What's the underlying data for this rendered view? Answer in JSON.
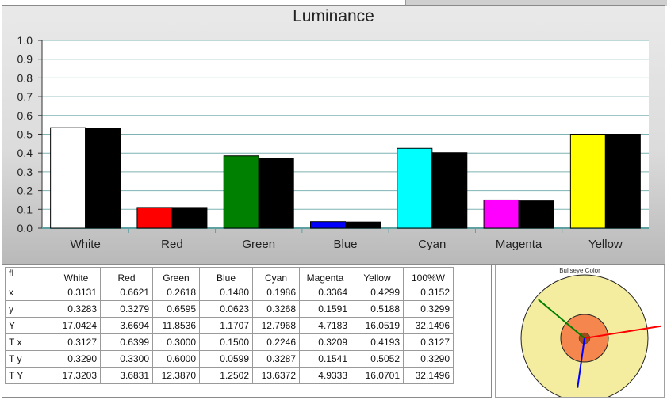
{
  "chart_data": {
    "type": "bar",
    "title": "Luminance",
    "categories": [
      "White",
      "Red",
      "Green",
      "Blue",
      "Cyan",
      "Magenta",
      "Yellow"
    ],
    "series": [
      {
        "values": [
          0.535,
          0.11,
          0.385,
          0.035,
          0.425,
          0.15,
          0.5
        ],
        "colors": [
          "#ffffff",
          "#ff0000",
          "#008000",
          "#0000ff",
          "#00ffff",
          "#ff00ff",
          "#ffff00"
        ]
      },
      {
        "values": [
          0.532,
          0.11,
          0.372,
          0.033,
          0.402,
          0.145,
          0.5
        ],
        "colors": [
          "#000000",
          "#000000",
          "#000000",
          "#000000",
          "#000000",
          "#000000",
          "#000000"
        ]
      }
    ],
    "ylim": [
      0,
      1.0
    ],
    "yticks": [
      "0.0",
      "0.1",
      "0.2",
      "0.3",
      "0.4",
      "0.5",
      "0.6",
      "0.7",
      "0.8",
      "0.9",
      "1.0"
    ],
    "grid": true
  },
  "table": {
    "corner": "fL",
    "columns": [
      "White",
      "Red",
      "Green",
      "Blue",
      "Cyan",
      "Magenta",
      "Yellow",
      "100%W"
    ],
    "rows": [
      {
        "label": "x",
        "values": [
          "0.3131",
          "0.6621",
          "0.2618",
          "0.1480",
          "0.1986",
          "0.3364",
          "0.4299",
          "0.3152"
        ]
      },
      {
        "label": "y",
        "values": [
          "0.3283",
          "0.3279",
          "0.6595",
          "0.0623",
          "0.3268",
          "0.1591",
          "0.5188",
          "0.3299"
        ]
      },
      {
        "label": "Y",
        "values": [
          "17.0424",
          "3.6694",
          "11.8536",
          "1.1707",
          "12.7968",
          "4.7183",
          "16.0519",
          "32.1496"
        ]
      },
      {
        "label": "T x",
        "values": [
          "0.3127",
          "0.6399",
          "0.3000",
          "0.1500",
          "0.2246",
          "0.3209",
          "0.4193",
          "0.3127"
        ]
      },
      {
        "label": "T y",
        "values": [
          "0.3290",
          "0.3300",
          "0.6000",
          "0.0599",
          "0.3287",
          "0.1541",
          "0.5052",
          "0.3290"
        ]
      },
      {
        "label": "T Y",
        "values": [
          "17.3203",
          "3.6831",
          "12.3870",
          "1.2502",
          "13.6372",
          "4.9333",
          "16.0701",
          "32.1496"
        ]
      }
    ]
  },
  "bullseye": {
    "title": "Bullseye Color",
    "colors": {
      "outer": "#f4eda0",
      "middle": "#f5874e",
      "center": "#9a4d1a"
    },
    "vectors": [
      {
        "color": "#008000",
        "angle_deg": 140,
        "length": 0.95
      },
      {
        "color": "#ff0000",
        "angle_deg": 9,
        "length": 1.22
      },
      {
        "color": "#0000ff",
        "angle_deg": 262,
        "length": 0.79
      }
    ]
  }
}
